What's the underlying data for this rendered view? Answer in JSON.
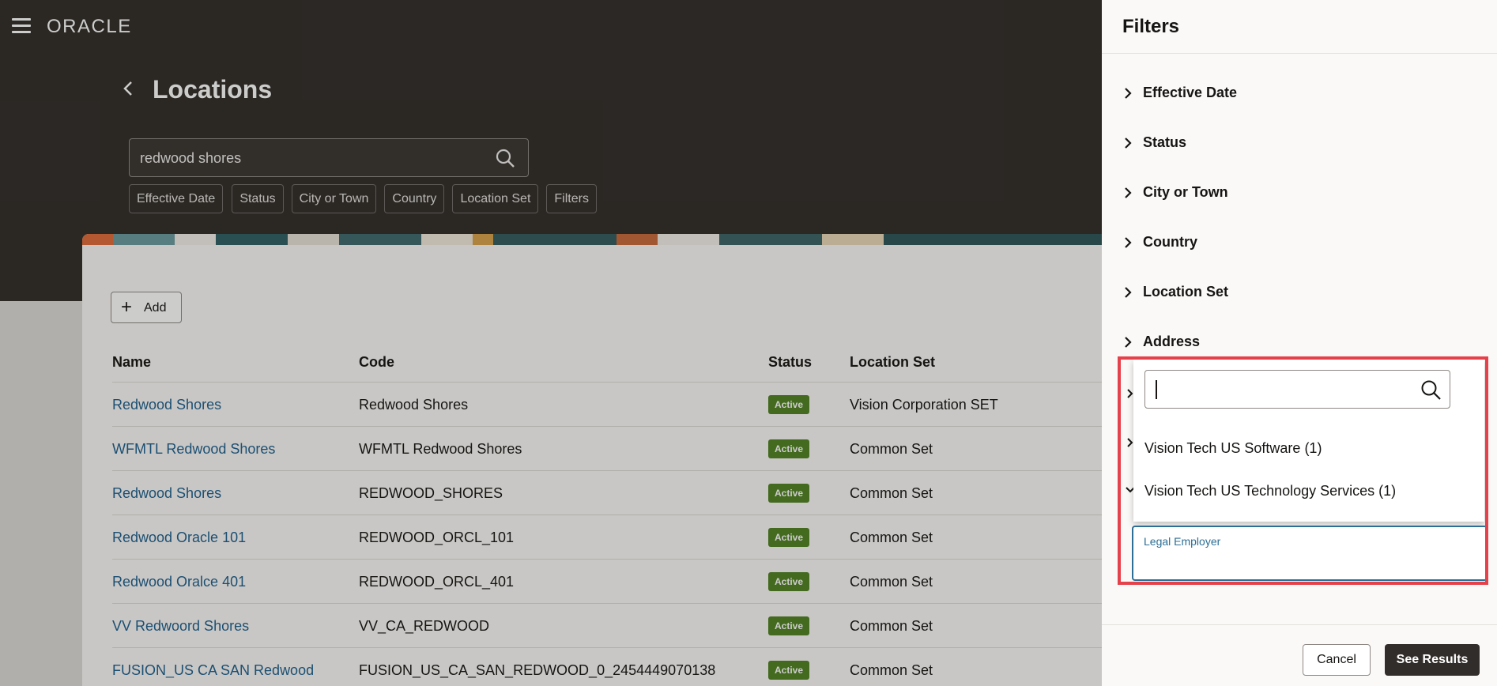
{
  "app": {
    "logo": "ORACLE"
  },
  "page": {
    "title": "Locations",
    "search_value": "redwood shores",
    "chips": [
      "Effective Date",
      "Status",
      "City or Town",
      "Country",
      "Location Set",
      "Filters"
    ],
    "add_label": "Add"
  },
  "table": {
    "headers": {
      "name": "Name",
      "code": "Code",
      "status": "Status",
      "location_set": "Location Set"
    },
    "rows": [
      {
        "name": "Redwood Shores",
        "code": "Redwood Shores",
        "status": "Active",
        "location_set": "Vision Corporation SET"
      },
      {
        "name": "WFMTL Redwood Shores",
        "code": "WFMTL Redwood Shores",
        "status": "Active",
        "location_set": "Common Set"
      },
      {
        "name": "Redwood Shores",
        "code": "REDWOOD_SHORES",
        "status": "Active",
        "location_set": "Common Set"
      },
      {
        "name": "Redwood Oracle 101",
        "code": "REDWOOD_ORCL_101",
        "status": "Active",
        "location_set": "Common Set"
      },
      {
        "name": "Redwood Oralce 401",
        "code": "REDWOOD_ORCL_401",
        "status": "Active",
        "location_set": "Common Set"
      },
      {
        "name": "VV Redwoord Shores",
        "code": "VV_CA_REDWOOD",
        "status": "Active",
        "location_set": "Common Set"
      },
      {
        "name": "FUSION_US CA SAN Redwood",
        "code": "FUSION_US_CA_SAN_REDWOOD_0_2454449070138",
        "status": "Active",
        "location_set": "Common Set"
      }
    ]
  },
  "filters": {
    "title": "Filters",
    "items": [
      "Effective Date",
      "Status",
      "City or Town",
      "Country",
      "Location Set",
      "Address"
    ],
    "dropdown": {
      "search_value": "",
      "options": [
        "Vision Tech US Software (1)",
        "Vision Tech US Technology Services (1)"
      ]
    },
    "legal_employer_label": "Legal Employer",
    "cancel_label": "Cancel",
    "see_results_label": "See Results"
  },
  "colors": {
    "active_badge": "#508223",
    "link": "#1d5f8d",
    "highlight": "#e5414a",
    "header_bg": "#312d2a"
  }
}
